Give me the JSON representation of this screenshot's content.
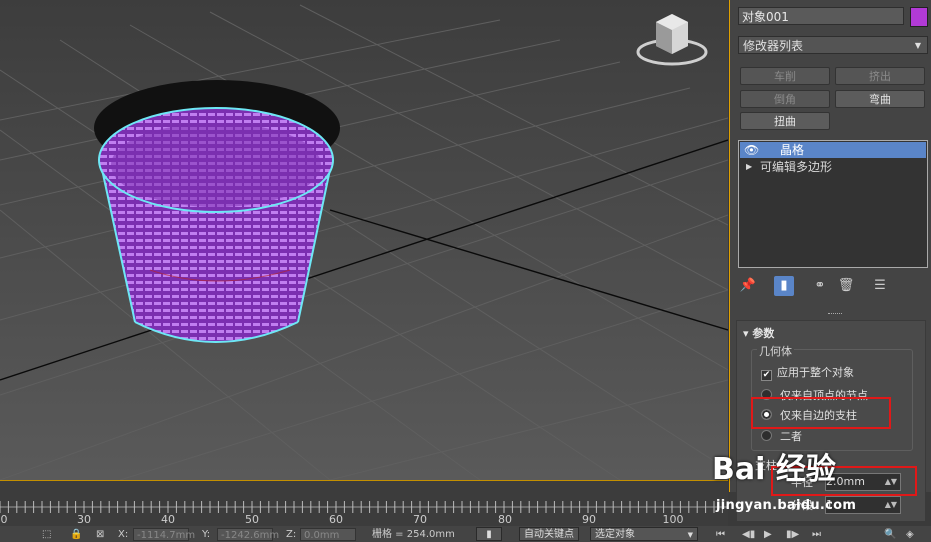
{
  "panel": {
    "object_name": "对象001",
    "object_color": "#b23ad6",
    "modifier_list_label": "修改器列表",
    "buttons": [
      {
        "label": "车削",
        "enabled": false
      },
      {
        "label": "挤出",
        "enabled": false
      },
      {
        "label": "倒角",
        "enabled": false
      },
      {
        "label": "弯曲",
        "enabled": true
      },
      {
        "label": "扭曲",
        "enabled": true
      }
    ],
    "stack": [
      {
        "label": "晶格",
        "selected": true
      },
      {
        "label": "可编辑多边形",
        "selected": false
      }
    ],
    "tools": [
      "pin-icon",
      "show-end-result-icon",
      "make-unique-icon",
      "trash-icon",
      "configure-icon"
    ],
    "rollout": {
      "title": "参数",
      "group_label": "几何体",
      "apply_all_label": "应用于整个对象",
      "apply_all_checked": true,
      "options": [
        {
          "label": "仅来自顶点的节点",
          "selected": false
        },
        {
          "label": "仅来自边的支柱",
          "selected": true
        },
        {
          "label": "二者",
          "selected": false
        }
      ],
      "struts_label": "支柱",
      "radius_label": "半径",
      "radius_value": "2.0mm",
      "segments_label": "分段",
      "segments_value": "1"
    }
  },
  "timeline": {
    "ticks": [
      "0",
      "30",
      "40",
      "50",
      "60",
      "70",
      "80",
      "90",
      "100"
    ]
  },
  "status": {
    "x_label": "X:",
    "x_value": "-1114.7mm",
    "y_label": "Y:",
    "y_value": "-1242.6mm",
    "z_label": "Z:",
    "z_value": "0.0mm",
    "grid_text": "栅格 = 254.0mm",
    "auto_key": "自动关键点",
    "selected_object": "选定对象"
  },
  "watermark": {
    "logo": "Bai 经验",
    "url": "jingyan.baidu.com"
  }
}
